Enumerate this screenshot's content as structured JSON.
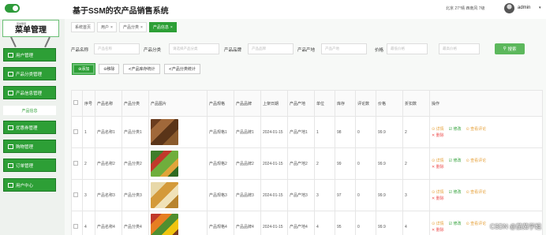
{
  "header": {
    "title": "基于SSM的农产品销售系统",
    "weather": "北京 27°晴 西南风 7级",
    "user": "admin"
  },
  "sidebar": {
    "menu_title": "菜单管理",
    "menu_subtitle": "菜单管理",
    "items": [
      {
        "label": "用户管理",
        "icon": "user-icon"
      },
      {
        "label": "产品分类管理",
        "icon": "category-icon"
      },
      {
        "label": "产品信息管理",
        "icon": "grid-icon"
      },
      {
        "label": "优惠券管理",
        "icon": "grid-icon"
      },
      {
        "label": "购物管理",
        "icon": "grid-icon"
      },
      {
        "label": "订单管理",
        "icon": "user-icon"
      },
      {
        "label": "用户中心",
        "icon": "monitor-icon"
      }
    ],
    "sub_active": "产品信息"
  },
  "tabs": [
    {
      "label": "系统首页",
      "closable": false,
      "active": false
    },
    {
      "label": "用户",
      "closable": true,
      "active": false
    },
    {
      "label": "产品分类",
      "closable": true,
      "active": false
    },
    {
      "label": "产品信息",
      "closable": true,
      "active": true
    }
  ],
  "search": {
    "fields": [
      {
        "label": "产品名称",
        "placeholder": "产品名称"
      },
      {
        "label": "产品分类",
        "placeholder": "请选择产品分类"
      },
      {
        "label": "产品品牌",
        "placeholder": "产品品牌"
      },
      {
        "label": "产品产地",
        "placeholder": "产品产地"
      },
      {
        "label": "价格",
        "placeholder": "最低价格"
      },
      {
        "label": "",
        "placeholder": "最高价格"
      }
    ],
    "button_label": "搜索"
  },
  "actions": [
    "添加",
    "移除",
    "产品库存统计",
    "产品分类统计"
  ],
  "table": {
    "headers": [
      "序号",
      "产品名称",
      "产品分类",
      "产品图片",
      "产品规格",
      "产品品牌",
      "上架日期",
      "产品产地",
      "单位",
      "库存",
      "评论数",
      "价格",
      "折扣数",
      "操作"
    ],
    "rows": [
      {
        "no": "1",
        "name": "产品名称1",
        "category": "产品分类1",
        "spec": "产品规格1",
        "brand": "产品品牌1",
        "date": "2024-01-15",
        "origin": "产品产地1",
        "unit": "1",
        "stock": "98",
        "comments": "0",
        "price": "99.9",
        "discount": "2"
      },
      {
        "no": "2",
        "name": "产品名称2",
        "category": "产品分类2",
        "spec": "产品规格2",
        "brand": "产品品牌2",
        "date": "2024-01-15",
        "origin": "产品产地2",
        "unit": "2",
        "stock": "99",
        "comments": "0",
        "price": "99.9",
        "discount": "2"
      },
      {
        "no": "3",
        "name": "产品名称3",
        "category": "产品分类3",
        "spec": "产品规格3",
        "brand": "产品品牌3",
        "date": "2024-01-15",
        "origin": "产品产地3",
        "unit": "3",
        "stock": "97",
        "comments": "0",
        "price": "99.9",
        "discount": "3"
      },
      {
        "no": "4",
        "name": "产品名称4",
        "category": "产品分类4",
        "spec": "产品规格4",
        "brand": "产品品牌4",
        "date": "2024-01-15",
        "origin": "产品产地4",
        "unit": "4",
        "stock": "95",
        "comments": "0",
        "price": "99.9",
        "discount": "4"
      }
    ],
    "ops": [
      "详情",
      "修改",
      "查看评论",
      "删除"
    ]
  },
  "watermark": "CSDN @茄茹学姐",
  "colors": {
    "accent": "#2d9f36",
    "warn": "#e6a23c",
    "danger": "#ee5555"
  }
}
